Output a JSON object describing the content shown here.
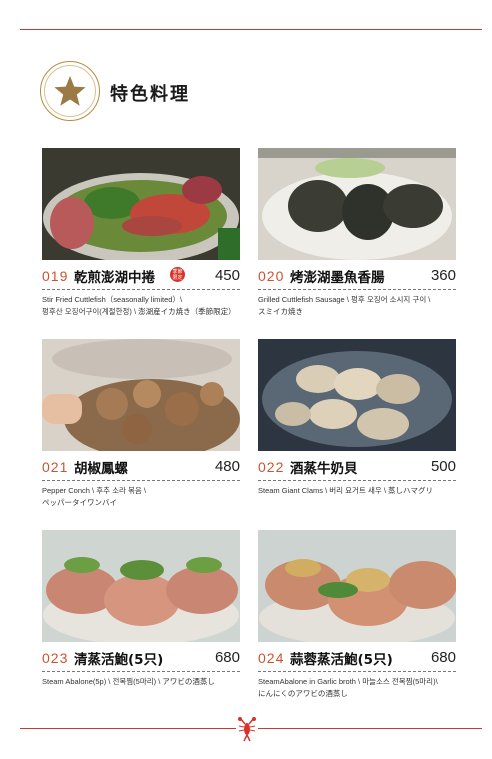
{
  "section": {
    "title": "特色料理",
    "icon": "star-icon"
  },
  "colors": {
    "rule": "#c43a36",
    "number": "#c9552f",
    "badge_ring": "#b98b3c",
    "star": "#9c7a45",
    "seal": "#d8322a"
  },
  "items": [
    {
      "number": "019",
      "name": "乾煎澎湖中捲",
      "price": "450",
      "tag": "季節限定",
      "desc_line1": "Stir Fried Cuttlefish（seasonally limited）\\",
      "desc_line2": "펑후산 오징어구이(계절한정) \\ 澎湖産イカ焼き（季節限定）"
    },
    {
      "number": "020",
      "name": "烤澎湖墨魚香腸",
      "price": "360",
      "desc_line1": "Grilled Cuttlefish Sausage \\ 펑후 오징어 소시지 구이 \\",
      "desc_line2": "スミイカ焼き"
    },
    {
      "number": "021",
      "name": "胡椒鳳螺",
      "price": "480",
      "desc_line1": "Pepper Conch \\ 후추 소라 볶음 \\",
      "desc_line2": "ペッパータイワンバイ"
    },
    {
      "number": "022",
      "name": "酒蒸牛奶貝",
      "price": "500",
      "desc_line1": "Steam Giant Clams \\ 버리 요거트 새우 \\ 蒸しハマグリ",
      "desc_line2": ""
    },
    {
      "number": "023",
      "name": "清蒸活鮑(5只)",
      "price": "680",
      "desc_line1": "Steam Abalone(5p) \\ 전복찜(5마리) \\ アワビの酒蒸し",
      "desc_line2": ""
    },
    {
      "number": "024",
      "name": "蒜蓉蒸活鮑(5只)",
      "price": "680",
      "desc_line1": "SteamAbalone in Garlic broth \\ 마늘소스 전복찜(5마리)\\",
      "desc_line2": "にんにくのアワビの酒蒸し"
    }
  ]
}
